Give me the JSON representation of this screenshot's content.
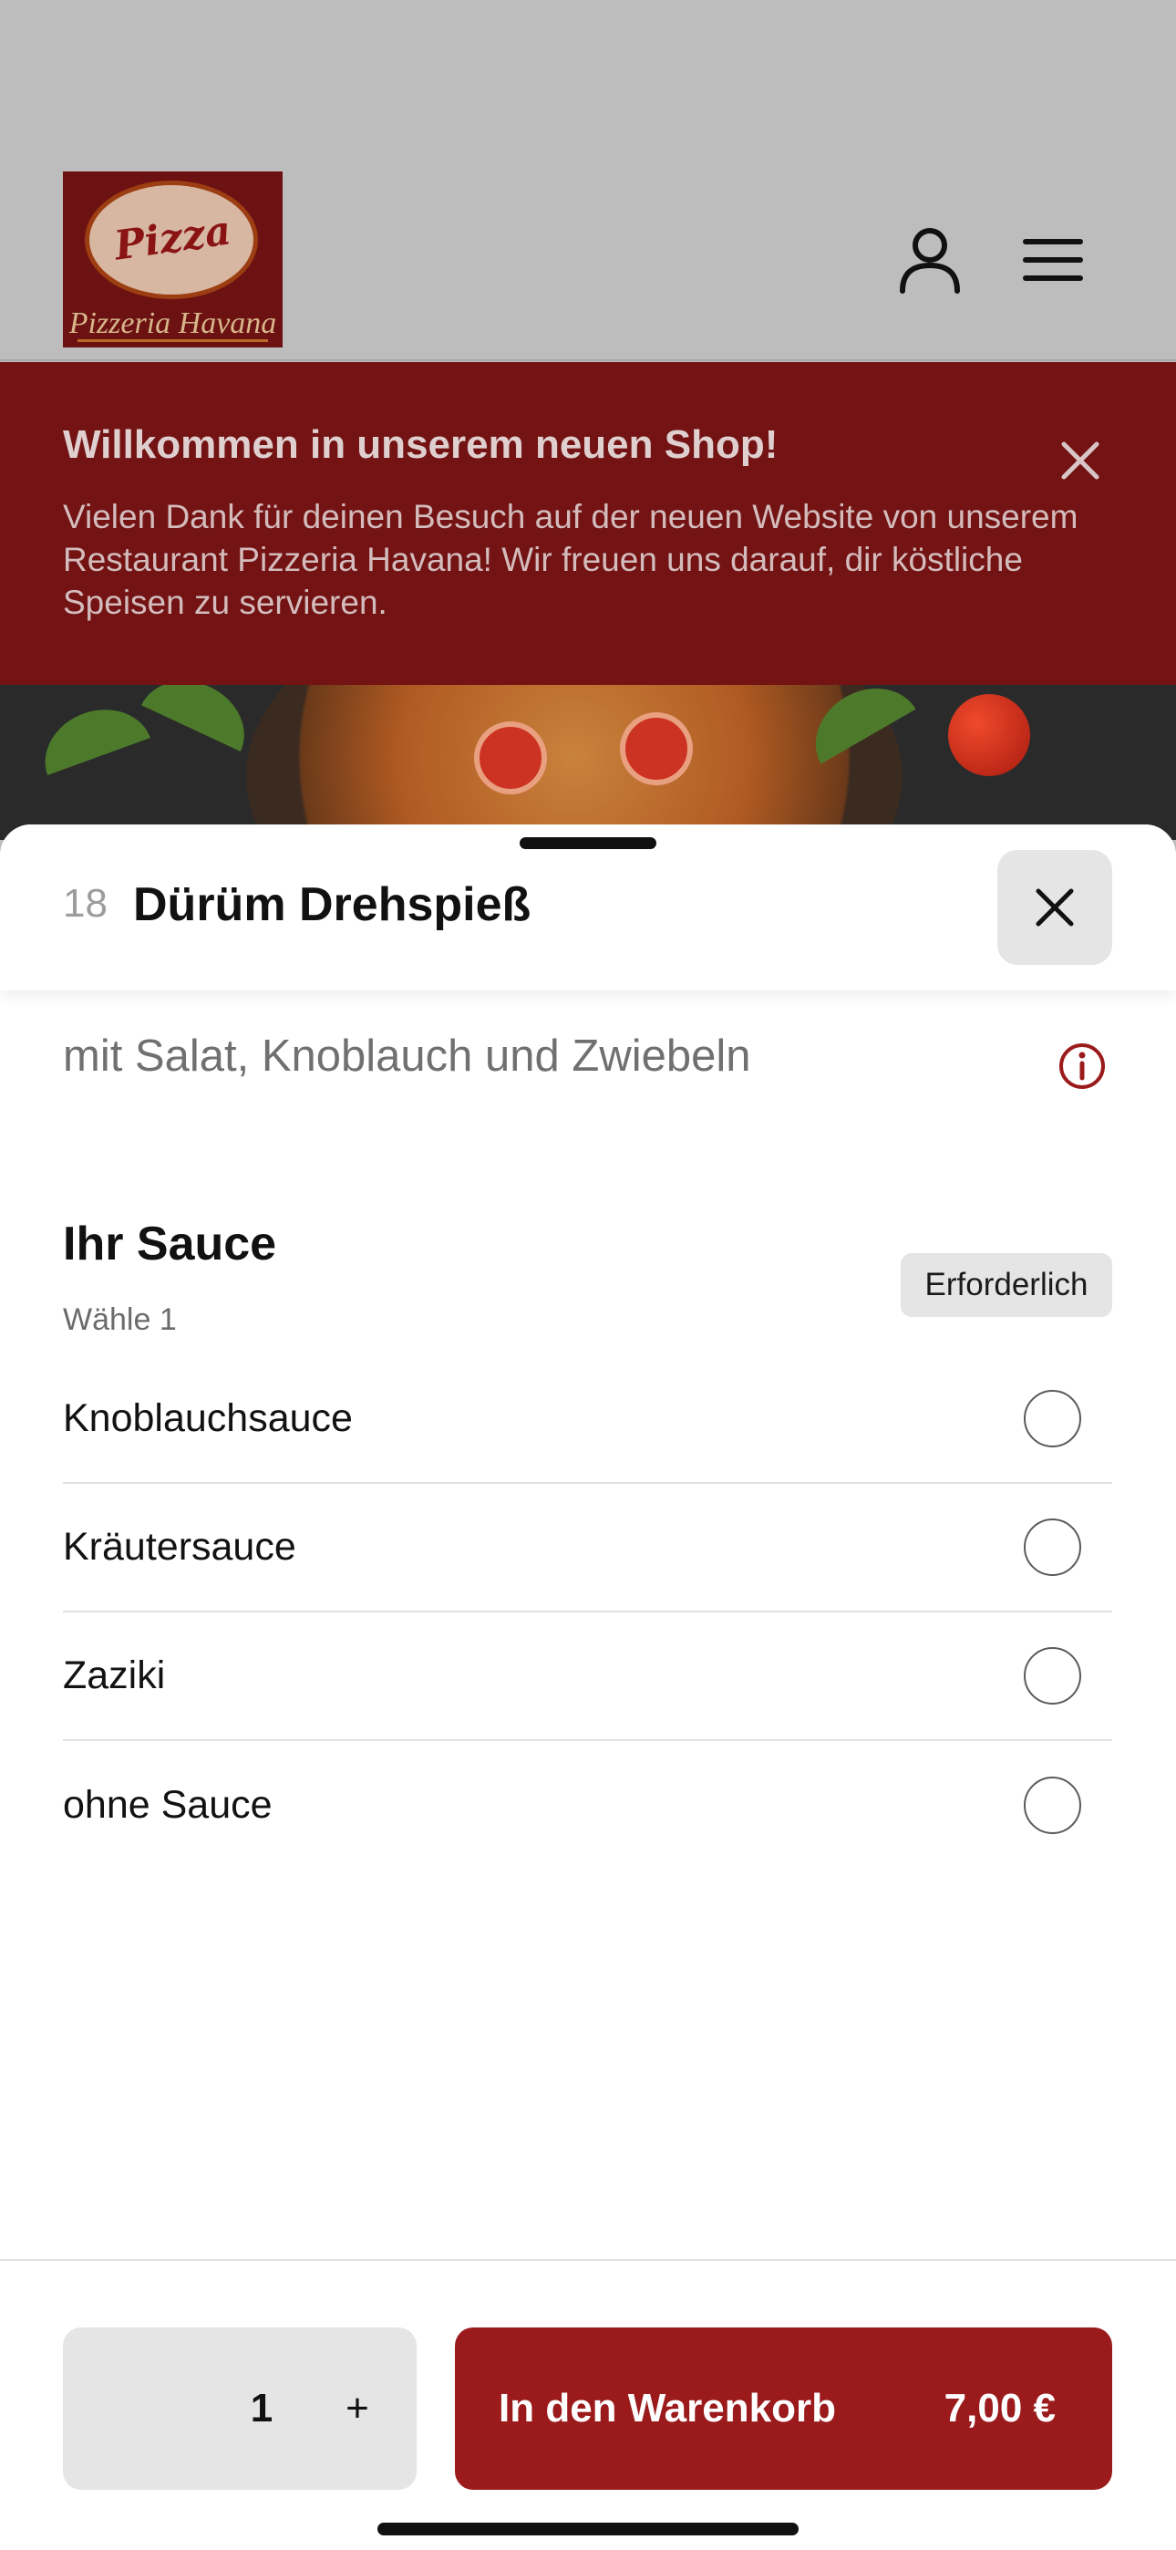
{
  "header": {
    "logo": {
      "word": "Pizza",
      "name": "Pizzeria Havana"
    },
    "icons": [
      "user-icon",
      "menu-icon"
    ]
  },
  "banner": {
    "title": "Willkommen in unserem neuen Shop!",
    "text": "Vielen Dank für deinen Besuch auf der neuen Website von unserem Restaurant Pizzeria Havana! Wir freuen uns darauf, dir köstliche Speisen zu servieren."
  },
  "item": {
    "number": "18",
    "title": "Dürüm Drehspieß",
    "description": "mit Salat, Knoblauch und Zwiebeln"
  },
  "sauce_group": {
    "title": "Ihr Sauce",
    "subtitle": "Wähle 1",
    "required_label": "Erforderlich",
    "options": [
      {
        "label": "Knoblauchsauce",
        "selected": false
      },
      {
        "label": "Kräutersauce",
        "selected": false
      },
      {
        "label": "Zaziki",
        "selected": false
      },
      {
        "label": "ohne Sauce",
        "selected": false
      }
    ]
  },
  "footer": {
    "quantity": "1",
    "plus_label": "+",
    "add_label": "In den Warenkorb",
    "price": "7,00 €"
  },
  "colors": {
    "accent": "#9b1b1c",
    "banner_bg": "#731314",
    "overlay_gray": "#bdbdbd"
  }
}
